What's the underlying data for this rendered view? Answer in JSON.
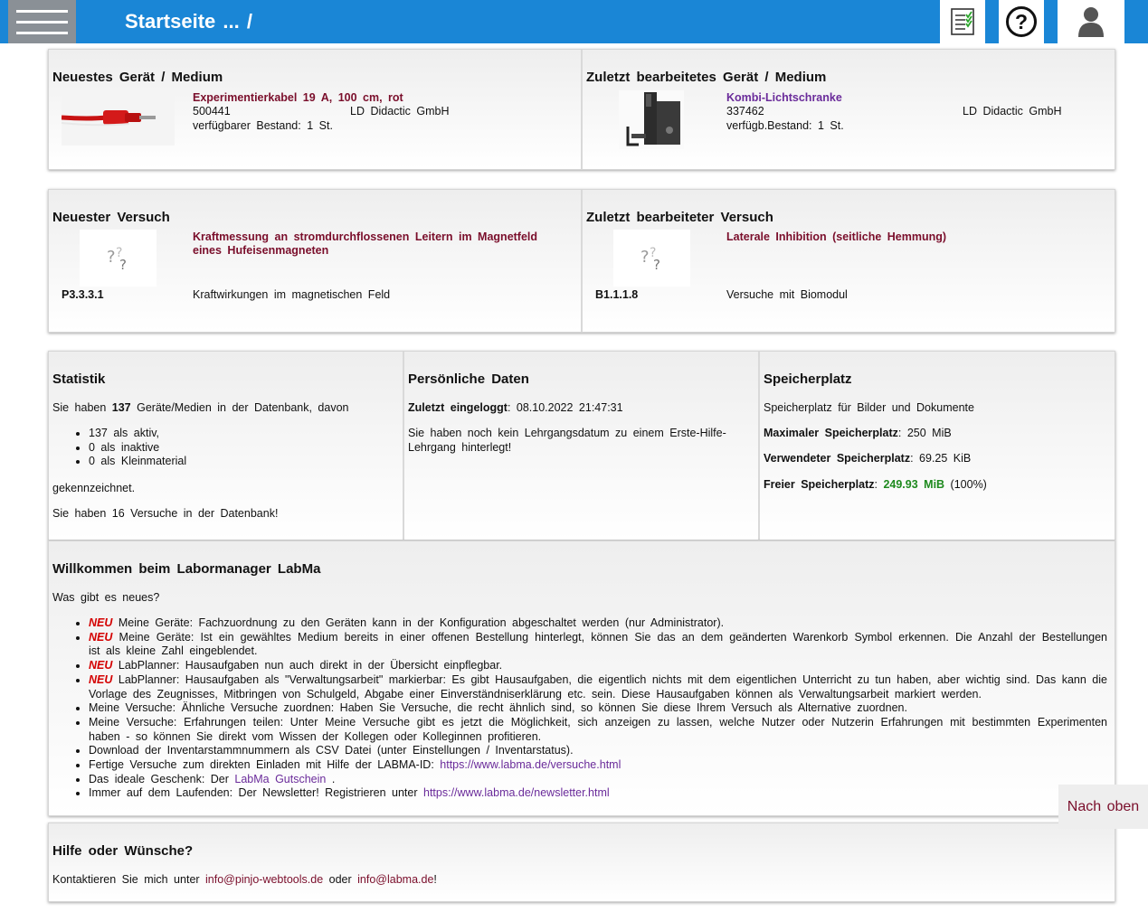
{
  "header": {
    "breadcrumb": "Startseite ... /",
    "menu_icon": "hamburger-icon",
    "list_icon": "checklist-icon",
    "help_icon": "help-circle-icon",
    "user_icon": "user-icon"
  },
  "newest_device": {
    "title": "Neuestes Gerät / Medium",
    "name": "Experimentierkabel 19 A, 100 cm, rot",
    "number": "500441",
    "maker": "LD Didactic GmbH",
    "stock": "verfügbarer Bestand: 1 St."
  },
  "last_device": {
    "title": "Zuletzt bearbeitetes Gerät / Medium",
    "name": "Kombi-Lichtschranke",
    "number": "337462",
    "maker": "LD Didactic GmbH",
    "stock": "verfügb.Bestand: 1 St."
  },
  "newest_experiment": {
    "title": "Neuester Versuch",
    "name": "Kraftmessung an stromdurchflossenen Leitern im Magnetfeld eines Hufeisenmagneten",
    "code": "P3.3.3.1",
    "topic": "Kraftwirkungen im magnetischen Feld"
  },
  "last_experiment": {
    "title": "Zuletzt bearbeiteter Versuch",
    "name": "Laterale Inhibition (seitliche Hemmung)",
    "code": "B1.1.1.8",
    "topic": "Versuche mit Biomodul"
  },
  "stats": {
    "title": "Statistik",
    "intro_pre": "Sie haben ",
    "count": "137",
    "intro_post": " Geräte/Medien in der Datenbank, davon",
    "items": [
      "137 als aktiv,",
      "0 als inaktive",
      "0 als Kleinmaterial"
    ],
    "marked": "gekennzeichnet.",
    "experiments": "Sie haben 16 Versuche in der Datenbank!"
  },
  "personal": {
    "title": "Persönliche Daten",
    "login_label": "Zuletzt eingeloggt",
    "login_value": ": 08.10.2022 21:47:31",
    "note": "Sie haben noch kein Lehrgangsdatum zu einem Erste-Hilfe-Lehrgang hinterlegt!"
  },
  "storage": {
    "title": "Speicherplatz",
    "desc": "Speicherplatz für Bilder und Dokumente",
    "max_label": "Maximaler Speicherplatz",
    "max_value": ": 250 MiB",
    "used_label": "Verwendeter Speicherplatz",
    "used_value": ": 69.25 KiB",
    "free_label": "Freier Speicherplatz",
    "free_sep": ": ",
    "free_value": "249.93 MiB",
    "free_pct": " (100%)",
    "free_fraction": 1.0
  },
  "welcome": {
    "title": "Willkommen beim Labormanager LabMa",
    "subtitle": "Was gibt es neues?",
    "neu": "NEU",
    "items": [
      " Meine Geräte: Fachzuordnung zu den Geräten kann in der Konfiguration abgeschaltet werden (nur Administrator).",
      " Meine Geräte: Ist ein gewähltes Medium bereits in einer offenen Bestellung hinterlegt, können Sie das an dem geänderten Warenkorb Symbol erkennen. Die Anzahl der Bestellungen ist als kleine Zahl eingeblendet.",
      " LabPlanner: Hausaufgaben nun auch direkt in der Übersicht einpflegbar.",
      " LabPlanner: Hausaufgaben als \"Verwaltungsarbeit\" markierbar: Es gibt Hausaufgaben, die eigentlich nichts mit dem eigentlichen Unterricht zu tun haben, aber wichtig sind. Das kann die Vorlage des Zeugnisses, Mitbringen von Schulgeld, Abgabe einer Einverständniserklärung etc. sein. Diese Hausaufgaben können als Verwaltungsarbeit markiert werden.",
      "Meine Versuche: Ähnliche Versuche zuordnen: Haben Sie Versuche, die recht ähnlich sind, so können Sie diese Ihrem Versuch als Alternative zuordnen.",
      "Meine Versuche: Erfahrungen teilen: Unter Meine Versuche gibt es jetzt die Möglichkeit, sich anzeigen zu lassen, welche Nutzer oder Nutzerin Erfahrungen mit bestimmten Experimenten haben - so können Sie direkt vom Wissen der Kollegen oder Kolleginnen profitieren.",
      "Download der Inventarstammnummern als CSV Datei (unter Einstellungen / Inventarstatus)."
    ],
    "versuche_pre": "Fertige Versuche zum direkten Einladen mit Hilfe der LABMA-ID: ",
    "versuche_link": "https://www.labma.de/versuche.html",
    "gift_pre": "Das ideale Geschenk: Der ",
    "gift_link": "LabMa Gutschein",
    "gift_post": " .",
    "news_pre": "Immer auf dem Laufenden: Der Newsletter! Registrieren unter ",
    "news_link": "https://www.labma.de/newsletter.html"
  },
  "help": {
    "title": "Hilfe oder Wünsche?",
    "pre": "Kontaktieren Sie mich unter ",
    "mail1": "info@pinjo-webtools.de",
    "mid": " oder ",
    "mail2": "info@labma.de",
    "post": "!"
  },
  "to_top": "Nach oben"
}
